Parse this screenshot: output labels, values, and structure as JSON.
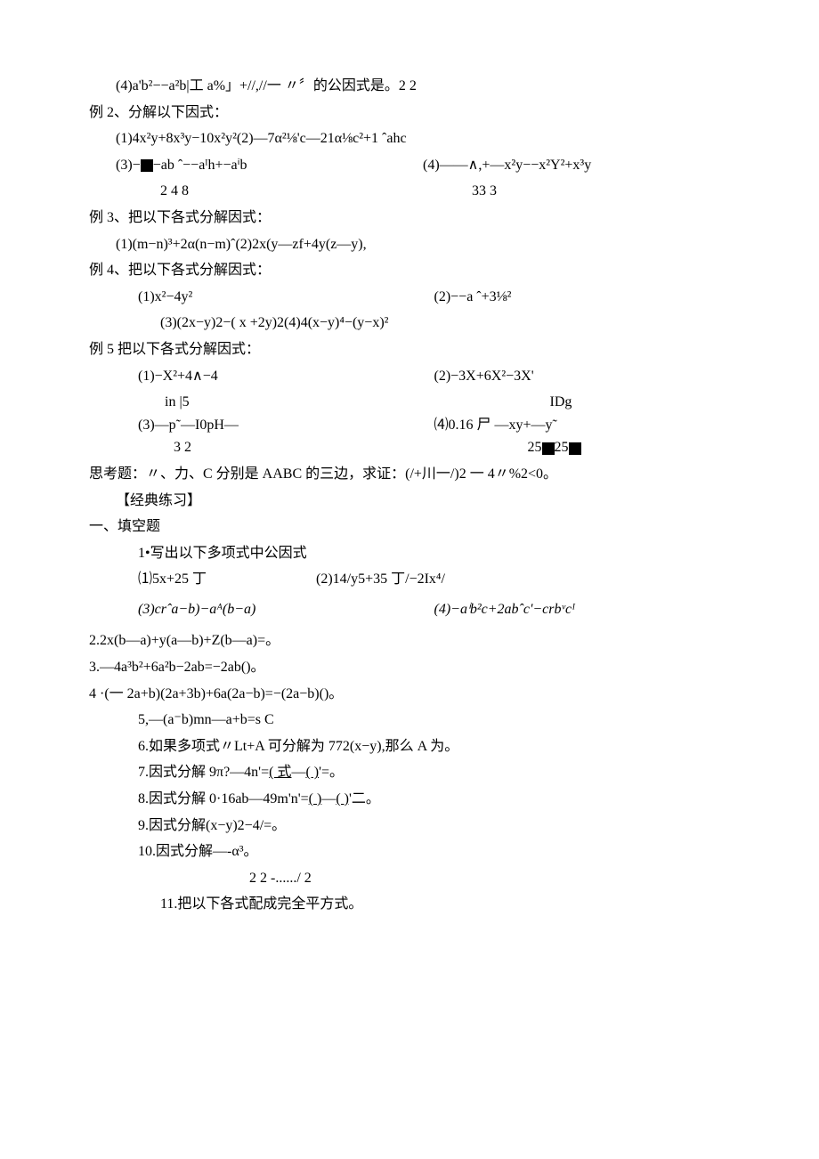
{
  "l1": "(4)a'b²−−a²b|工 a%」+//,//一 〃〞的公因式是。2    2",
  "l2": "例 2、分解以下因式：",
  "l3": "(1)4x²y+8x³y−10x²y²(2)—7α²⅛'c—21α⅛c²+1 ˆahc",
  "l4_left": "(3)−",
  "l4_left2": "−ab ˆ−−aᴵh+−aⁱb",
  "l4_right": "(4)——∧,+—x²y−−x²Y²+x³y",
  "l4b_left": "2   4    8",
  "l4b_right": "33       3",
  "l5": "例 3、把以下各式分解因式：",
  "l6": "(1)(m−n)³+2α(n−m)ˆ(2)2x(y—zf+4y(z—y),",
  "l7": "例 4、把以下各式分解因式：",
  "l8_left": "(1)x²−4y²",
  "l8_right": "(2)−−a ˆ+3⅛²",
  "l9": "(3)(2x−y)2−( x +2y)2(4)4(x−y)⁴−(y−x)²",
  "l10": "例 5 把以下各式分解因式：",
  "l11_left": "(1)−X²+4∧−4",
  "l11_right": "(2)−3X+6X²−3X'",
  "l12_left_top": "in       |5",
  "l12_left_mid": "(3)—p˜—I0pH—",
  "l12_left_bot": "3       2",
  "l12_right_top": "IDg",
  "l12_right_mid": "⑷0.16 尸 —xy+—y˜",
  "l12_right_bot": "25",
  "l12_right_bot2": "25",
  "l13": "思考题：〃、力、C 分别是 AABC 的三边，求证：(/+川一/)2 一 4〃%2<0。",
  "l14": "【经典练习】",
  "l15": "一、填空题",
  "l16": "1•写出以下多项式中公因式",
  "l17_left": "⑴5x+25 丁",
  "l17_right": "(2)14/y5+35 丁/−2Ix⁴/",
  "l18_left": "(3)crˆa−b)−aᴬ(b−a)",
  "l18_right": "(4)−aⁱb²c+2abˆc'−crbᵛcᴵ",
  "l19": "2.2x(b—a)+y(a—b)+Z(b—a)=。",
  "l20": "3.—4a³b²+6a²b−2ab=−2ab()。",
  "l21": "4 ·(一 2a+b)(2a+3b)+6a(2a−b)=−(2a−b)()。",
  "l22": "5,—(a⁻b)mn—a+b=s C",
  "l23": "6.如果多项式〃Lt+A 可分解为 772(x−y),那么 A 为。",
  "l24_a": "7.因式分解 9π?—4n'=",
  "l24_b": "( 式",
  "l24_c": "—",
  "l24_d": "(   )",
  "l24_e": "'=。",
  "l25_a": "8.因式分解 0·16ab—49m'n'=",
  "l25_b": "(   )",
  "l25_c": "—",
  "l25_d": "(   )",
  "l25_e": "'二。",
  "l26": "9.因式分解(x−y)2−4/=。",
  "l27": "10.因式分解—-α³。",
  "l28": "2       2  -....../   2",
  "l29": "11.把以下各式配成完全平方式。"
}
